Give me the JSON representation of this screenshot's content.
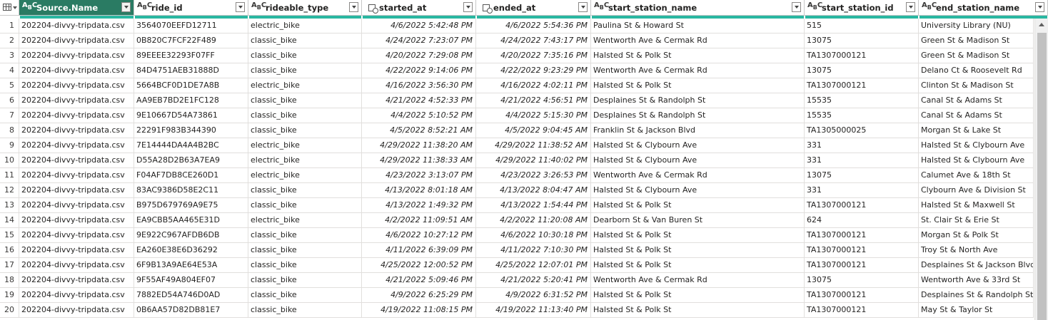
{
  "columns": [
    {
      "name": "Source.Name",
      "type": "text"
    },
    {
      "name": "ride_id",
      "type": "text"
    },
    {
      "name": "rideable_type",
      "type": "text"
    },
    {
      "name": "started_at",
      "type": "datetime"
    },
    {
      "name": "ended_at",
      "type": "datetime"
    },
    {
      "name": "start_station_name",
      "type": "text"
    },
    {
      "name": "start_station_id",
      "type": "text"
    },
    {
      "name": "end_station_name",
      "type": "text"
    }
  ],
  "type_icon_text": {
    "a": "A",
    "b": "B",
    "c": "C"
  },
  "rows": [
    {
      "i": "1",
      "src": "202204-divvy-tripdata.csv",
      "ride_id": "3564070EEFD12711",
      "type": "electric_bike",
      "start": "4/6/2022 5:42:48 PM",
      "end": "4/6/2022 5:54:36 PM",
      "sname": "Paulina St & Howard St",
      "sid": "515",
      "ename": "University Library (NU)"
    },
    {
      "i": "2",
      "src": "202204-divvy-tripdata.csv",
      "ride_id": "0B820C7FCF22F489",
      "type": "classic_bike",
      "start": "4/24/2022 7:23:07 PM",
      "end": "4/24/2022 7:43:17 PM",
      "sname": "Wentworth Ave & Cermak Rd",
      "sid": "13075",
      "ename": "Green St & Madison St"
    },
    {
      "i": "3",
      "src": "202204-divvy-tripdata.csv",
      "ride_id": "89EEEE32293F07FF",
      "type": "classic_bike",
      "start": "4/20/2022 7:29:08 PM",
      "end": "4/20/2022 7:35:16 PM",
      "sname": "Halsted St & Polk St",
      "sid": "TA1307000121",
      "ename": "Green St & Madison St"
    },
    {
      "i": "4",
      "src": "202204-divvy-tripdata.csv",
      "ride_id": "84D4751AEB31888D",
      "type": "classic_bike",
      "start": "4/22/2022 9:14:06 PM",
      "end": "4/22/2022 9:23:29 PM",
      "sname": "Wentworth Ave & Cermak Rd",
      "sid": "13075",
      "ename": "Delano Ct & Roosevelt Rd"
    },
    {
      "i": "5",
      "src": "202204-divvy-tripdata.csv",
      "ride_id": "5664BCF0D1DE7A8B",
      "type": "electric_bike",
      "start": "4/16/2022 3:56:30 PM",
      "end": "4/16/2022 4:02:11 PM",
      "sname": "Halsted St & Polk St",
      "sid": "TA1307000121",
      "ename": "Clinton St & Madison St"
    },
    {
      "i": "6",
      "src": "202204-divvy-tripdata.csv",
      "ride_id": "AA9EB7BD2E1FC128",
      "type": "classic_bike",
      "start": "4/21/2022 4:52:33 PM",
      "end": "4/21/2022 4:56:51 PM",
      "sname": "Desplaines St & Randolph St",
      "sid": "15535",
      "ename": "Canal St & Adams St"
    },
    {
      "i": "7",
      "src": "202204-divvy-tripdata.csv",
      "ride_id": "9E10667D54A73861",
      "type": "classic_bike",
      "start": "4/4/2022 5:10:52 PM",
      "end": "4/4/2022 5:15:30 PM",
      "sname": "Desplaines St & Randolph St",
      "sid": "15535",
      "ename": "Canal St & Adams St"
    },
    {
      "i": "8",
      "src": "202204-divvy-tripdata.csv",
      "ride_id": "22291F983B344390",
      "type": "classic_bike",
      "start": "4/5/2022 8:52:21 AM",
      "end": "4/5/2022 9:04:45 AM",
      "sname": "Franklin St & Jackson Blvd",
      "sid": "TA1305000025",
      "ename": "Morgan St & Lake St"
    },
    {
      "i": "9",
      "src": "202204-divvy-tripdata.csv",
      "ride_id": "7E14444DA4A4B2BC",
      "type": "electric_bike",
      "start": "4/29/2022 11:38:20 AM",
      "end": "4/29/2022 11:38:52 AM",
      "sname": "Halsted St & Clybourn Ave",
      "sid": "331",
      "ename": "Halsted St & Clybourn Ave"
    },
    {
      "i": "10",
      "src": "202204-divvy-tripdata.csv",
      "ride_id": "D55A28D2B63A7EA9",
      "type": "electric_bike",
      "start": "4/29/2022 11:38:33 AM",
      "end": "4/29/2022 11:40:02 PM",
      "sname": "Halsted St & Clybourn Ave",
      "sid": "331",
      "ename": "Halsted St & Clybourn Ave"
    },
    {
      "i": "11",
      "src": "202204-divvy-tripdata.csv",
      "ride_id": "F04AF7DB8CE260D1",
      "type": "electric_bike",
      "start": "4/23/2022 3:13:07 PM",
      "end": "4/23/2022 3:26:53 PM",
      "sname": "Wentworth Ave & Cermak Rd",
      "sid": "13075",
      "ename": "Calumet Ave & 18th St"
    },
    {
      "i": "12",
      "src": "202204-divvy-tripdata.csv",
      "ride_id": "83AC9386D58E2C11",
      "type": "classic_bike",
      "start": "4/13/2022 8:01:18 AM",
      "end": "4/13/2022 8:04:47 AM",
      "sname": "Halsted St & Clybourn Ave",
      "sid": "331",
      "ename": "Clybourn Ave & Division St"
    },
    {
      "i": "13",
      "src": "202204-divvy-tripdata.csv",
      "ride_id": "B975D679769A9E75",
      "type": "classic_bike",
      "start": "4/13/2022 1:49:32 PM",
      "end": "4/13/2022 1:54:44 PM",
      "sname": "Halsted St & Polk St",
      "sid": "TA1307000121",
      "ename": "Halsted St & Maxwell St"
    },
    {
      "i": "14",
      "src": "202204-divvy-tripdata.csv",
      "ride_id": "EA9CBB5AA465E31D",
      "type": "electric_bike",
      "start": "4/2/2022 11:09:51 AM",
      "end": "4/2/2022 11:20:08 AM",
      "sname": "Dearborn St & Van Buren St",
      "sid": "624",
      "ename": "St. Clair St & Erie St"
    },
    {
      "i": "15",
      "src": "202204-divvy-tripdata.csv",
      "ride_id": "9E922C967AFDB6DB",
      "type": "classic_bike",
      "start": "4/6/2022 10:27:12 PM",
      "end": "4/6/2022 10:30:18 PM",
      "sname": "Halsted St & Polk St",
      "sid": "TA1307000121",
      "ename": "Morgan St & Polk St"
    },
    {
      "i": "16",
      "src": "202204-divvy-tripdata.csv",
      "ride_id": "EA260E38E6D36292",
      "type": "classic_bike",
      "start": "4/11/2022 6:39:09 PM",
      "end": "4/11/2022 7:10:30 PM",
      "sname": "Halsted St & Polk St",
      "sid": "TA1307000121",
      "ename": "Troy St & North Ave"
    },
    {
      "i": "17",
      "src": "202204-divvy-tripdata.csv",
      "ride_id": "6F9B13A9AE64E53A",
      "type": "classic_bike",
      "start": "4/25/2022 12:00:52 PM",
      "end": "4/25/2022 12:07:01 PM",
      "sname": "Halsted St & Polk St",
      "sid": "TA1307000121",
      "ename": "Desplaines St & Jackson Blvd"
    },
    {
      "i": "18",
      "src": "202204-divvy-tripdata.csv",
      "ride_id": "9F55AF49A804EF07",
      "type": "classic_bike",
      "start": "4/21/2022 5:09:46 PM",
      "end": "4/21/2022 5:20:41 PM",
      "sname": "Wentworth Ave & Cermak Rd",
      "sid": "13075",
      "ename": "Wentworth Ave & 33rd St"
    },
    {
      "i": "19",
      "src": "202204-divvy-tripdata.csv",
      "ride_id": "7882ED54A746D0AD",
      "type": "classic_bike",
      "start": "4/9/2022 6:25:29 PM",
      "end": "4/9/2022 6:31:52 PM",
      "sname": "Halsted St & Polk St",
      "sid": "TA1307000121",
      "ename": "Desplaines St & Randolph St"
    },
    {
      "i": "20",
      "src": "202204-divvy-tripdata.csv",
      "ride_id": "0B6AA57D82DB81E7",
      "type": "classic_bike",
      "start": "4/19/2022 11:08:15 PM",
      "end": "4/19/2022 11:13:40 PM",
      "sname": "Halsted St & Polk St",
      "sid": "TA1307000121",
      "ename": "May St & Taylor St"
    }
  ],
  "colors": {
    "selected_header": "#2a7b63",
    "quality_bar": "#2ab7a1"
  }
}
